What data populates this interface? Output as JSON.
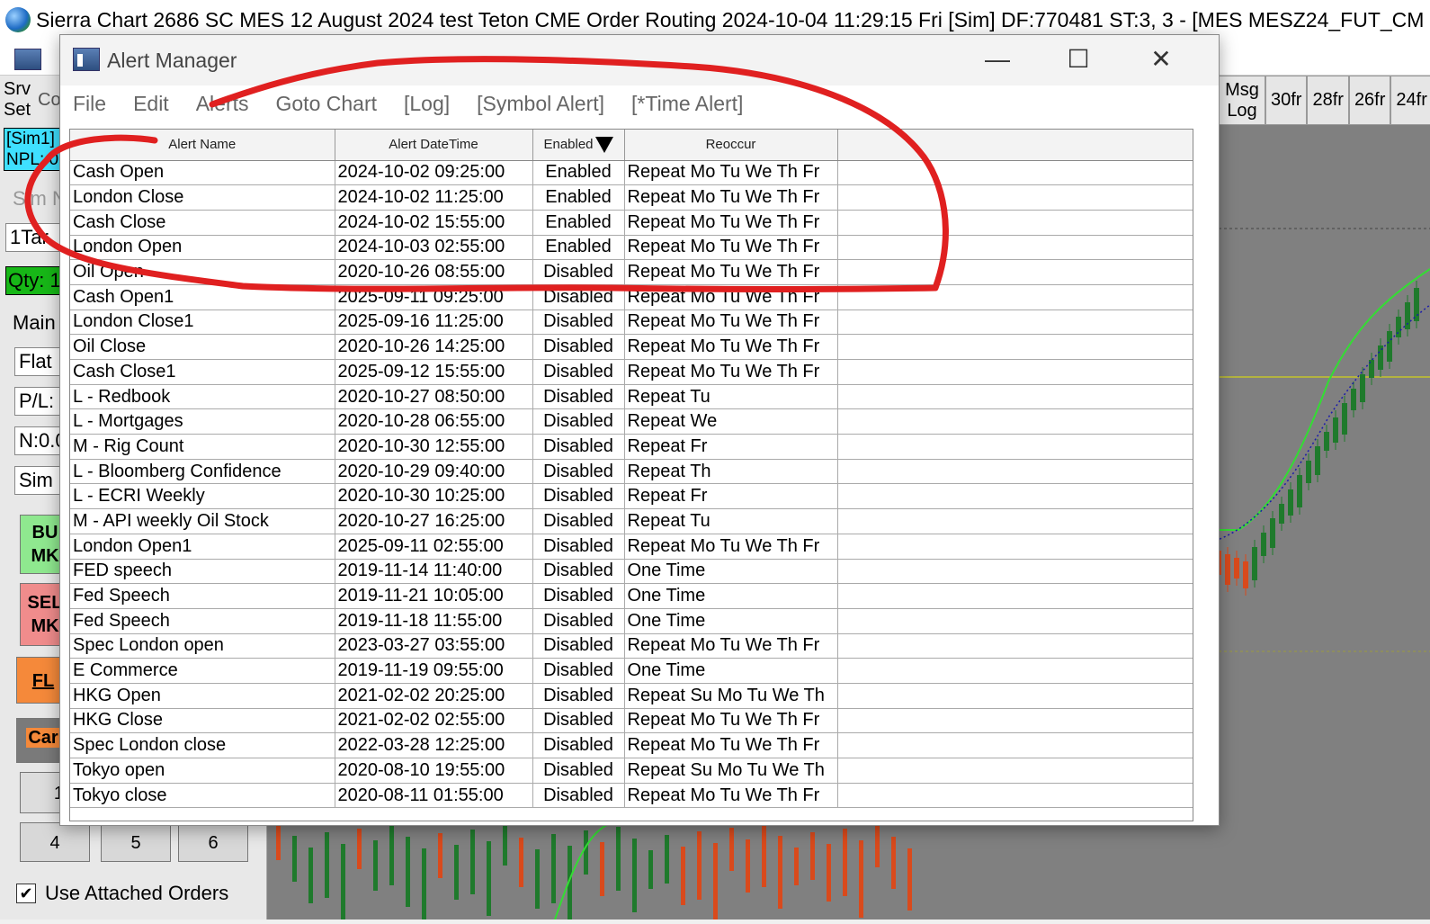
{
  "app": {
    "title": "Sierra Chart 2686 SC MES 12 August 2024 test Teton CME Order Routing 2024-10-04  11:29:15 Fri [Sim] DF:770481  ST:3, 3 - [MES MESZ24_FUT_CM"
  },
  "left_panel": {
    "srv_set_1": "Srv",
    "srv_set_2": "Set",
    "co_label": "Co",
    "sim_badge_1": "[Sim1]",
    "sim_badge_2": "NPL: 0",
    "sim_label": "Sim N",
    "target_field": "1Tar",
    "qty_label": "Qty: 1",
    "main_label": "Main",
    "flat_label": "Flat",
    "pl_label": "P/L:",
    "n_label": "N:0.0",
    "sim_field": "Sim",
    "buy_1": "BU",
    "buy_2": "MK",
    "sell_1": "SEL",
    "sell_2": "MK",
    "flatten": "FL",
    "cancel": "Car",
    "num_1": "1",
    "num_4": "4",
    "num_5": "5",
    "num_6": "6",
    "use_attached": "Use Attached Orders"
  },
  "chart_buttons": [
    "Msg Log",
    "30fr",
    "28fr",
    "26fr",
    "24fr"
  ],
  "dialog": {
    "title": "Alert Manager",
    "minimize": "—",
    "maximize": "☐",
    "close": "✕",
    "menu": [
      "File",
      "Edit",
      "Alerts",
      "Goto Chart",
      "[Log]",
      "[Symbol Alert]",
      "[*Time Alert]"
    ],
    "columns": [
      "Alert Name",
      "Alert DateTime",
      "Enabled",
      "Reoccur"
    ],
    "rows": [
      [
        "Cash Open",
        "2024-10-02  09:25:00",
        "Enabled",
        "Repeat Mo Tu We Th Fr"
      ],
      [
        "London Close",
        "2024-10-02  11:25:00",
        "Enabled",
        "Repeat Mo Tu We Th Fr"
      ],
      [
        "Cash Close",
        "2024-10-02  15:55:00",
        "Enabled",
        "Repeat Mo Tu We Th Fr"
      ],
      [
        "London Open",
        "2024-10-03  02:55:00",
        "Enabled",
        "Repeat Mo Tu We Th Fr"
      ],
      [
        "Oil Open",
        "2020-10-26  08:55:00",
        "Disabled",
        "Repeat Mo Tu We Th Fr"
      ],
      [
        "Cash Open1",
        "2025-09-11  09:25:00",
        "Disabled",
        "Repeat Mo Tu We Th Fr"
      ],
      [
        "London Close1",
        "2025-09-16  11:25:00",
        "Disabled",
        "Repeat Mo Tu We Th Fr"
      ],
      [
        "Oil Close",
        "2020-10-26  14:25:00",
        "Disabled",
        "Repeat Mo Tu We Th Fr"
      ],
      [
        "Cash Close1",
        "2025-09-12  15:55:00",
        "Disabled",
        "Repeat Mo Tu We Th Fr"
      ],
      [
        "L - Redbook",
        "2020-10-27  08:50:00",
        "Disabled",
        "Repeat Tu"
      ],
      [
        "L - Mortgages",
        "2020-10-28  06:55:00",
        "Disabled",
        "Repeat We"
      ],
      [
        "M - Rig Count",
        "2020-10-30  12:55:00",
        "Disabled",
        "Repeat Fr"
      ],
      [
        "L - Bloomberg Confidence",
        "2020-10-29  09:40:00",
        "Disabled",
        "Repeat Th"
      ],
      [
        "L - ECRI Weekly",
        "2020-10-30  10:25:00",
        "Disabled",
        "Repeat Fr"
      ],
      [
        "M - API weekly Oil Stock",
        "2020-10-27  16:25:00",
        "Disabled",
        "Repeat Tu"
      ],
      [
        "London Open1",
        "2025-09-11  02:55:00",
        "Disabled",
        "Repeat Mo Tu We Th Fr"
      ],
      [
        "FED speech",
        "2019-11-14  11:40:00",
        "Disabled",
        "One Time"
      ],
      [
        "Fed Speech",
        "2019-11-21  10:05:00",
        "Disabled",
        "One Time"
      ],
      [
        "Fed Speech",
        "2019-11-18  11:55:00",
        "Disabled",
        "One Time"
      ],
      [
        "Spec London open",
        "2023-03-27  03:55:00",
        "Disabled",
        "Repeat Mo Tu We Th Fr"
      ],
      [
        "E Commerce",
        "2019-11-19  09:55:00",
        "Disabled",
        "One Time"
      ],
      [
        "HKG Open",
        "2021-02-02  20:25:00",
        "Disabled",
        "Repeat Su Mo Tu We Th"
      ],
      [
        "HKG Close",
        "2021-02-02  02:55:00",
        "Disabled",
        "Repeat Mo Tu We Th Fr"
      ],
      [
        "Spec London close",
        "2022-03-28  12:25:00",
        "Disabled",
        "Repeat Mo Tu We Th Fr"
      ],
      [
        "Tokyo open",
        "2020-08-10  19:55:00",
        "Disabled",
        "Repeat Su Mo Tu We Th"
      ],
      [
        "Tokyo close",
        "2020-08-11  01:55:00",
        "Disabled",
        "Repeat Mo Tu We Th Fr"
      ]
    ]
  },
  "colors": {
    "annotation": "#e02020",
    "chart_bg": "#808080",
    "up_candle": "#1f7a2c",
    "down_candle": "#d94a1c",
    "ma_line": "#33dd33",
    "dotted_line": "#1a1aaa"
  }
}
